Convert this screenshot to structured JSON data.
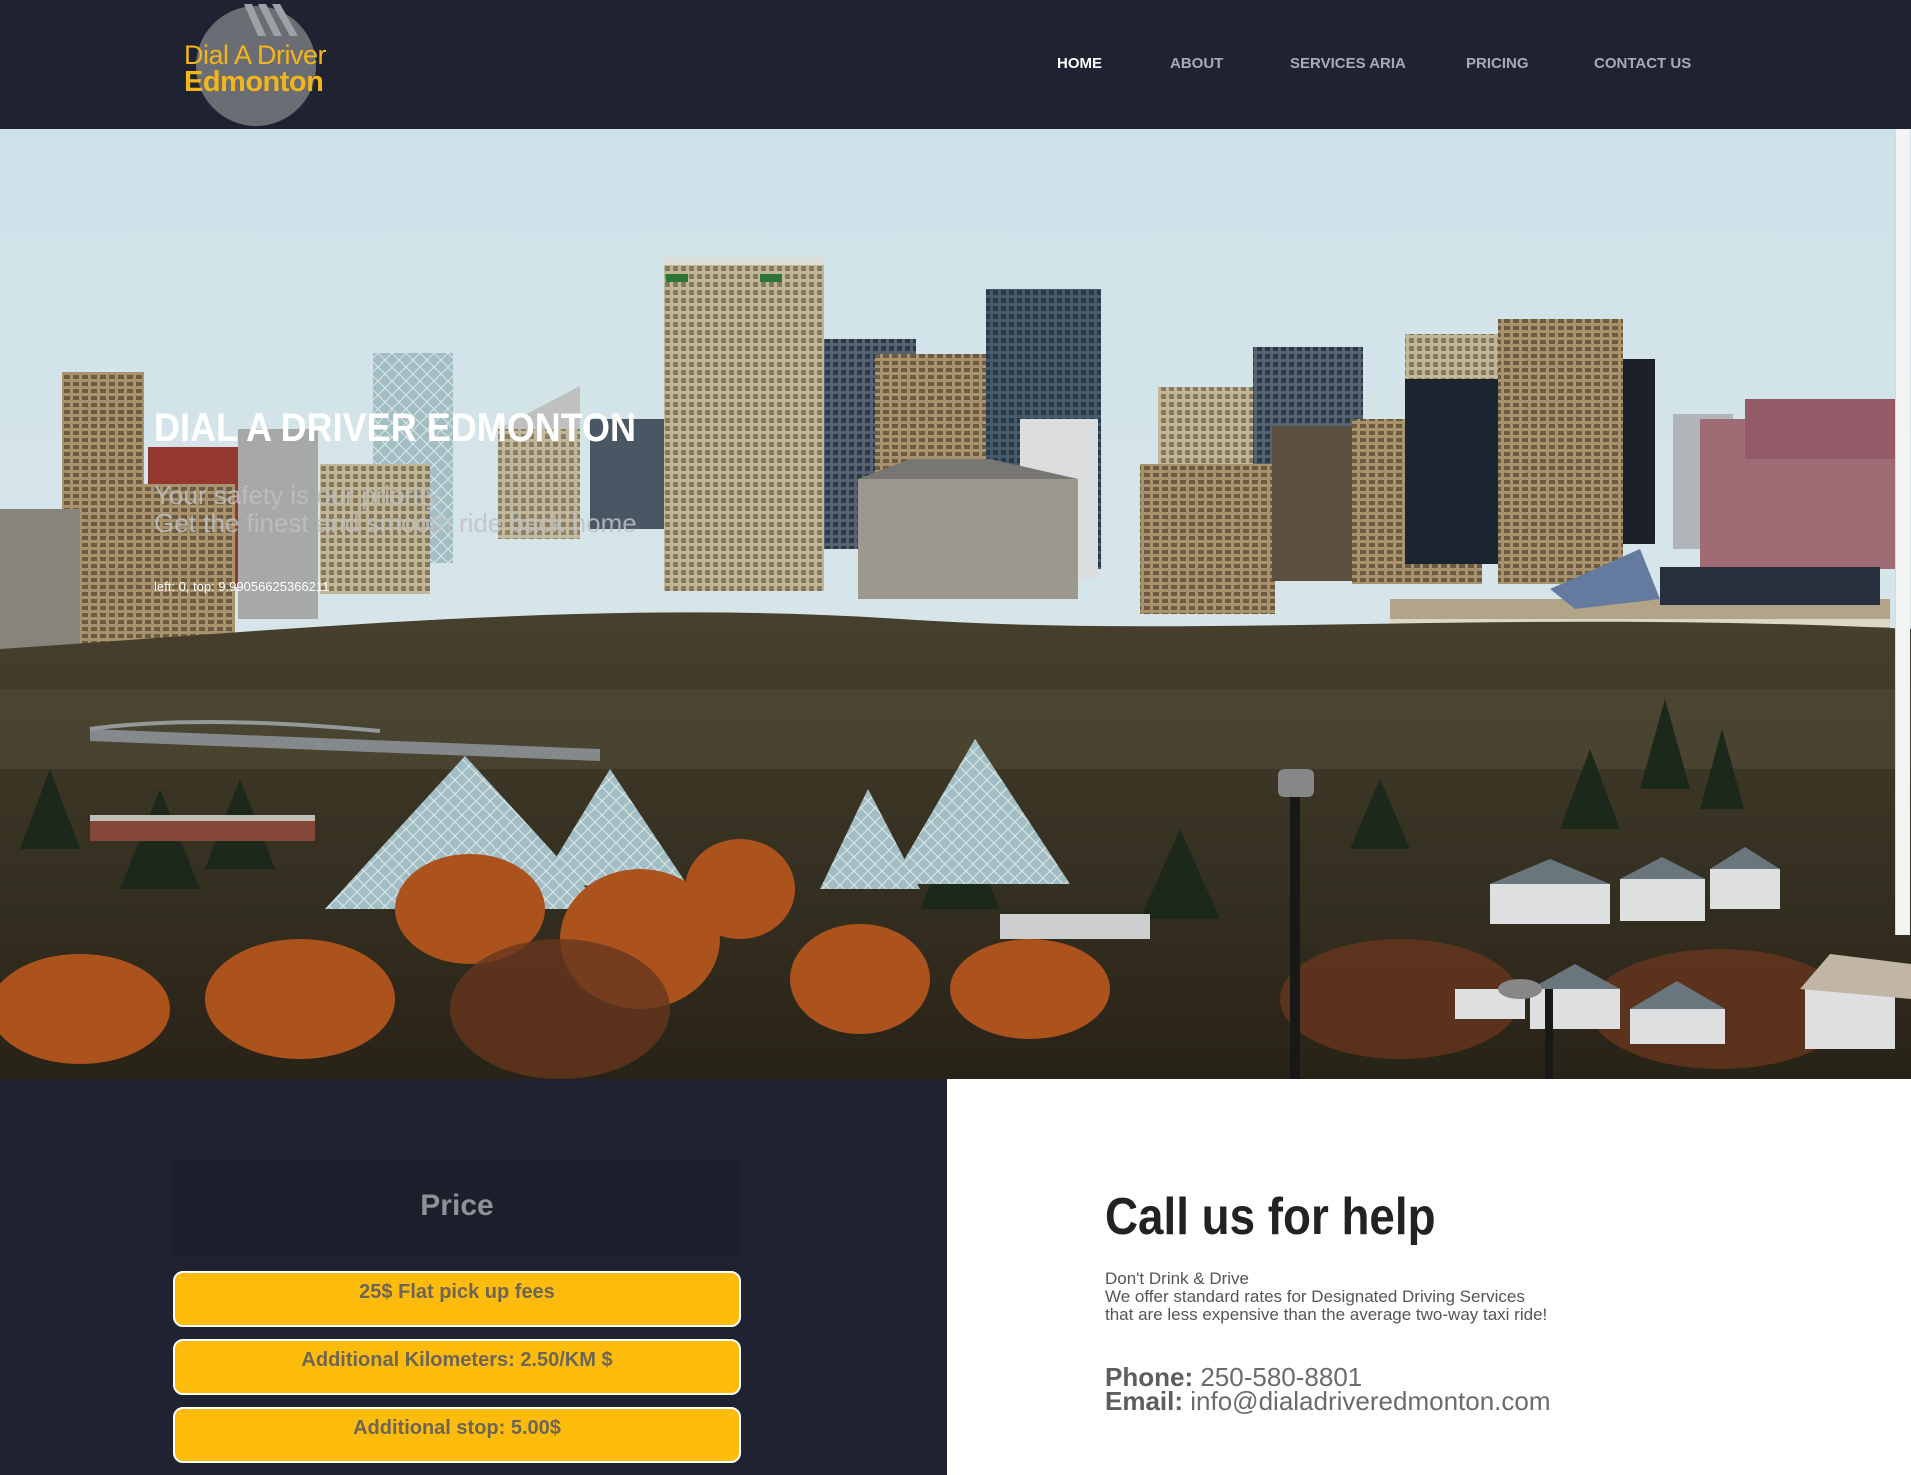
{
  "header": {
    "logo": {
      "line1": "Dial A Driver",
      "line2": "Edmonton"
    },
    "nav": [
      {
        "label": "HOME",
        "active": true
      },
      {
        "label": "ABOUT",
        "active": false
      },
      {
        "label": "SERVICES ARIA",
        "active": false
      },
      {
        "label": "PRICING",
        "active": false
      },
      {
        "label": "CONTACT US",
        "active": false
      }
    ]
  },
  "hero": {
    "title": "DIAL A DRIVER EDMONTON",
    "subtitle_line1": "Your safety is our priority.",
    "subtitle_line2": "Get the finest and smooth ride back home",
    "debug_text": "left: 0, top: 9.99056625366211",
    "image": "edmonton-skyline-photo"
  },
  "price": {
    "title": "Price",
    "items": [
      "25$ Flat pick up fees",
      "Additional Kilometers: 2.50/KM $",
      "Additional stop: 5.00$"
    ]
  },
  "contact": {
    "title": "Call us for help",
    "line1": "Don't Drink & Drive",
    "line2": "We offer standard rates for Designated Driving Services",
    "line3": "that are less expensive than the average two-way taxi ride!",
    "phone_label": "Phone:",
    "phone_value": "250-580-8801",
    "email_label": "Email:",
    "email_value": "info@dialadriveredmonton.com"
  },
  "colors": {
    "header_bg": "#1f2230",
    "accent_yellow": "#fdbc0c",
    "logo_yellow": "#f2b61a",
    "nav_active": "#ffffff",
    "nav_inactive": "#a9abb2"
  }
}
